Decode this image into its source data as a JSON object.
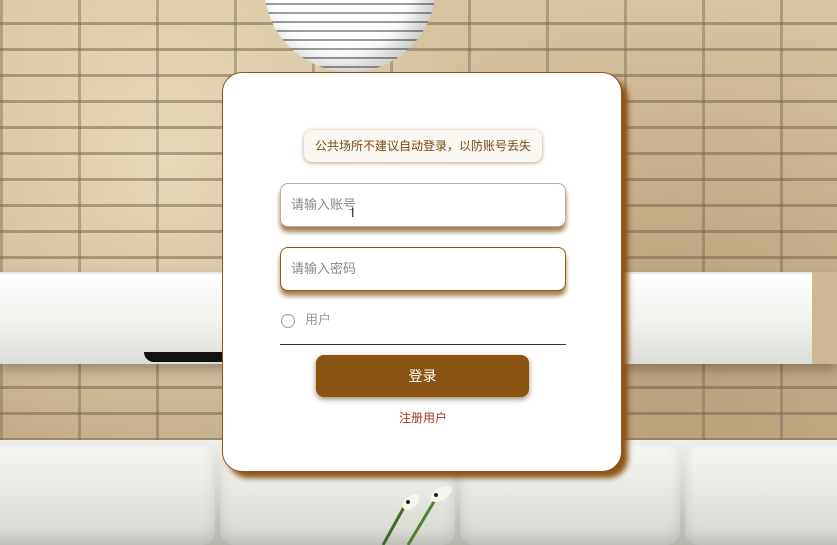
{
  "login": {
    "notice": "公共场所不建议自动登录，以防账号丢失",
    "account_placeholder": "请输入账号",
    "password_placeholder": "请输入密码",
    "role_label": "用户",
    "login_label": "登录",
    "register_label": "注册用户"
  },
  "colors": {
    "accent": "#8b5412",
    "register_link": "#a3361a"
  }
}
